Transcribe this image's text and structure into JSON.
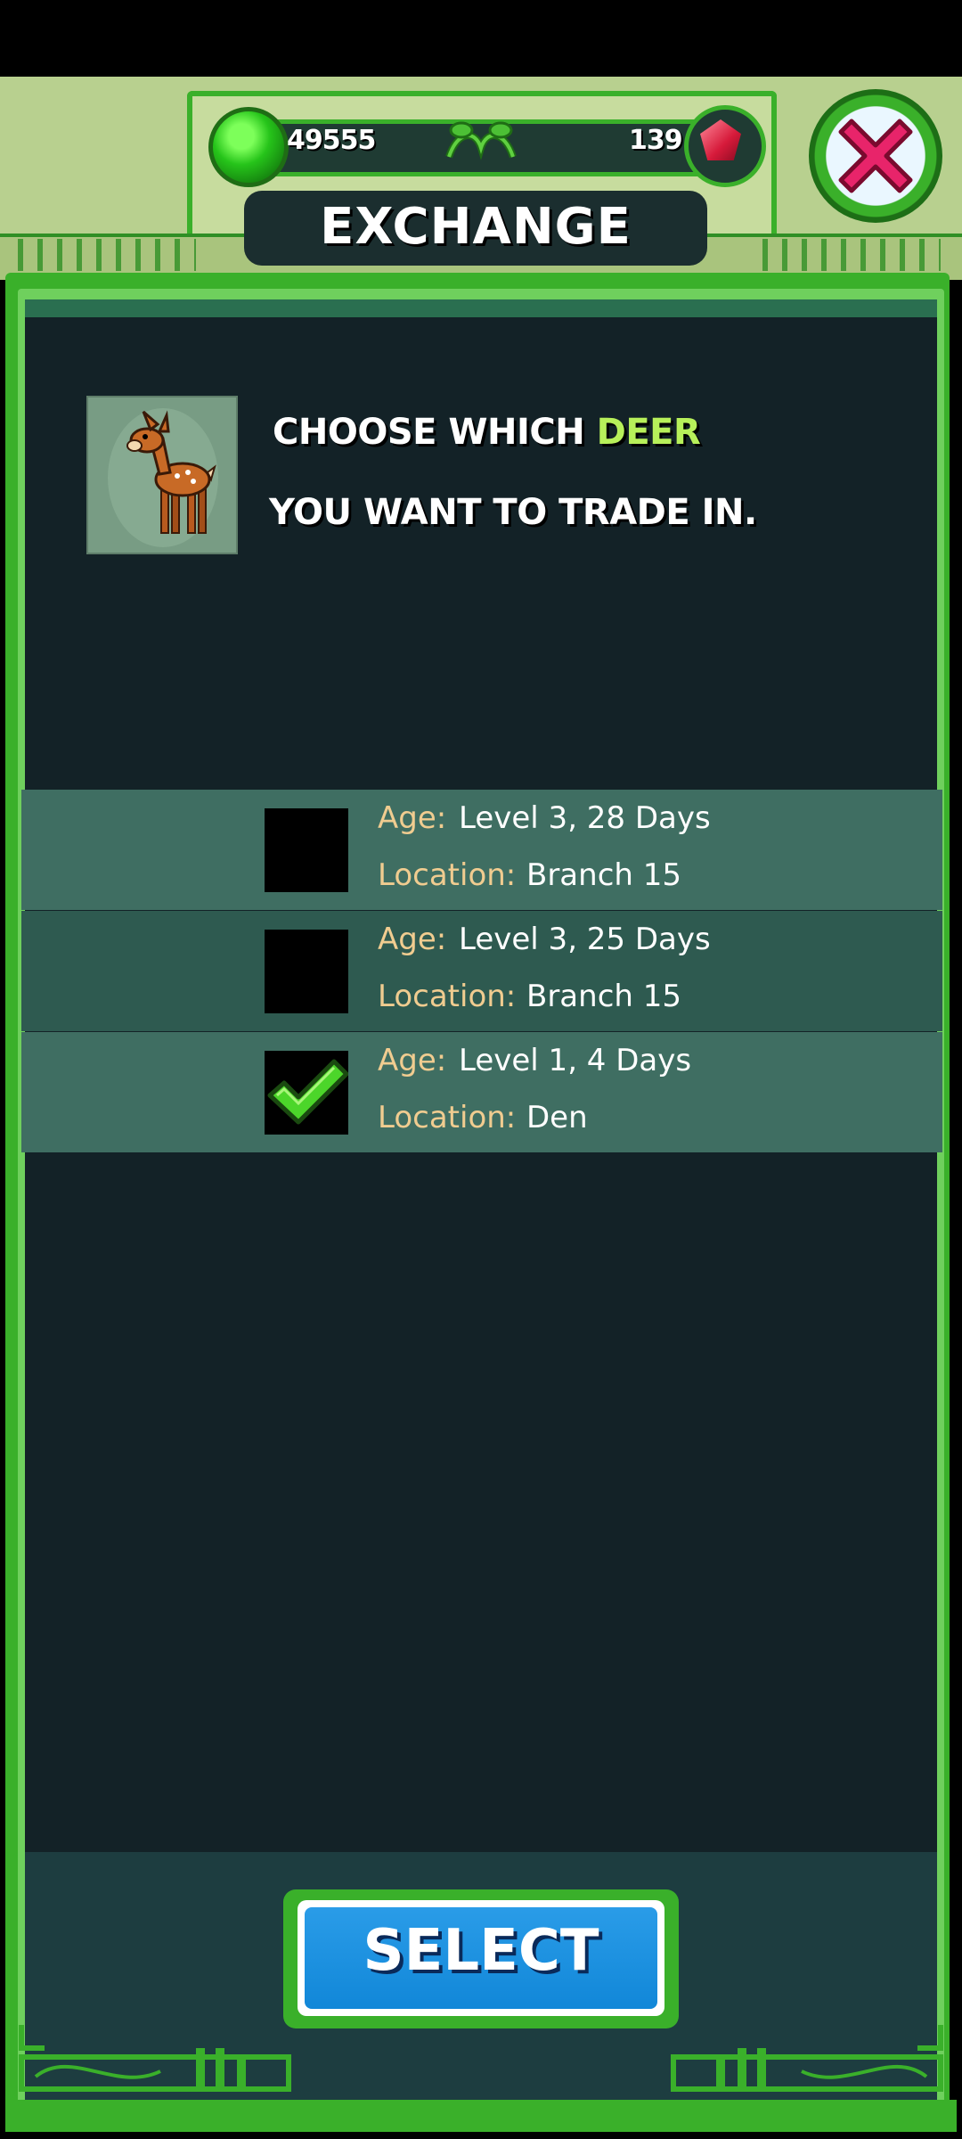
{
  "header": {
    "emerald_count": "49555",
    "ruby_count": "139",
    "title": "EXCHANGE"
  },
  "prompt": {
    "line1_prefix": "CHOOSE WHICH ",
    "animal": "DEER",
    "line2": "YOU WANT TO TRADE IN."
  },
  "entries": [
    {
      "age_label": "Age:",
      "age": "Level 3, 28 Days",
      "location_label": "Location:",
      "location": "Branch 15",
      "checked": false
    },
    {
      "age_label": "Age:",
      "age": "Level 3, 25 Days",
      "location_label": "Location:",
      "location": "Branch 15",
      "checked": false
    },
    {
      "age_label": "Age:",
      "age": "Level 1, 4 Days",
      "location_label": "Location:",
      "location": "Den",
      "checked": true
    }
  ],
  "select_button": {
    "label": "SELECT"
  },
  "colors": {
    "frame_green": "#3ab02a",
    "panel_dark": "#132227",
    "row_light": "#3f6e62",
    "row_dark": "#2e5a50",
    "label_tan": "#f0cc90",
    "deer_highlight": "#b7f05a",
    "select_blue": "#1187d8"
  },
  "icons": {
    "currency_left": "green-gem-icon",
    "currency_right": "red-crystal-icon",
    "close": "close-x-icon",
    "check": "checkmark-icon",
    "thumbnail": "deer-icon"
  }
}
